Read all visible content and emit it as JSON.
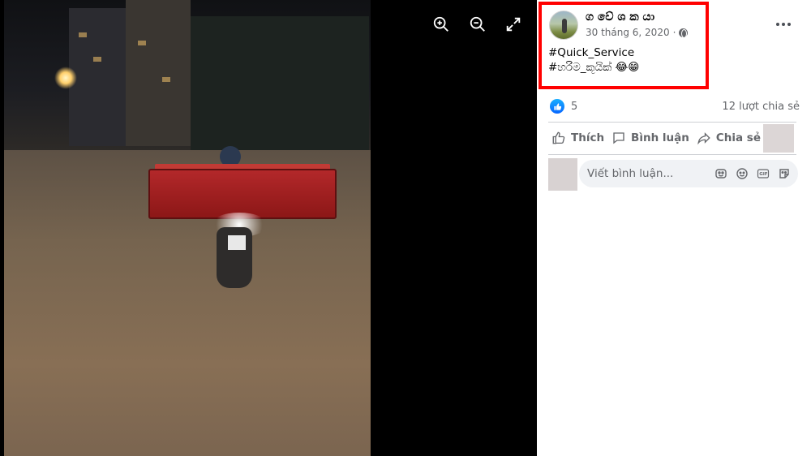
{
  "viewer": {
    "controls": [
      {
        "name": "zoom-in-icon"
      },
      {
        "name": "zoom-out-icon"
      },
      {
        "name": "fullscreen-icon"
      }
    ]
  },
  "post": {
    "author": "ග වේ ශ ක යා",
    "date": "30 tháng 6, 2020",
    "separator": "·",
    "audience_icon": "globe-icon",
    "text_line1": "#Quick_Service",
    "text_line2": "#හරිම_කූයික් 😂😁",
    "more_icon": "more-options-icon"
  },
  "stats": {
    "reaction_icon": "like-icon",
    "reactions": "5",
    "shares": "12 lượt chia sẻ"
  },
  "actions": {
    "like_label": "Thích",
    "comment_label": "Bình luận",
    "share_label": "Chia sẻ"
  },
  "comment": {
    "placeholder": "Viết bình luận..."
  },
  "colors": {
    "highlight": "#ff0000",
    "like_blue": "#0766ff",
    "secondary_text": "#65676b"
  }
}
